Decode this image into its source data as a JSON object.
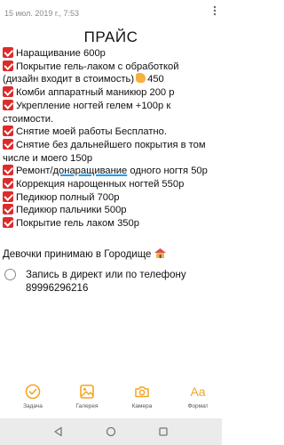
{
  "header": {
    "timestamp": "15 июл. 2019 г., 7:53"
  },
  "note": {
    "title": "ПРАЙС",
    "lines": [
      {
        "segments": [
          "Наращивание 600р"
        ]
      },
      {
        "segments": [
          "Покрытие гель-лаком с обработкой"
        ]
      },
      {
        "segments": [
          "(дизайн входит в стоимость)",
          "450"
        ]
      },
      {
        "segments": [
          "Комби аппаратный маникюр 200 р"
        ]
      },
      {
        "segments": [
          "Укрепление ногтей гелем +100р к"
        ]
      },
      {
        "segments": [
          "стоимости."
        ]
      },
      {
        "segments": [
          "Снятие моей работы Бесплатно."
        ]
      },
      {
        "segments": [
          "Снятие без дальнейшего покрытия в том"
        ]
      },
      {
        "segments": [
          "числе и моего 150р"
        ]
      },
      {
        "segments": [
          "Ремонт/",
          "донаращивание",
          " одного ногтя 50р"
        ]
      },
      {
        "segments": [
          "Коррекция нарощенных ногтей 550р"
        ]
      },
      {
        "segments": [
          "Педикюр полный 700р"
        ]
      },
      {
        "segments": [
          "Педикюр пальчики 500р"
        ]
      },
      {
        "segments": [
          "Покрытие гель лаком 350р"
        ]
      }
    ],
    "greeting": "Девочки принимаю в Городище",
    "checklist": {
      "line1": "Запись в директ или по телефону",
      "line2": "89996296216"
    }
  },
  "toolbar": {
    "items": [
      {
        "label": "Задача",
        "icon": "task-check-icon"
      },
      {
        "label": "Галерея",
        "icon": "gallery-icon"
      },
      {
        "label": "Камера",
        "icon": "camera-icon"
      },
      {
        "label": "Формат",
        "icon": "format-icon",
        "glyph": "Aa"
      }
    ]
  },
  "colors": {
    "accent": "#f4a623",
    "check": "#dd2b2b",
    "underline": "#1aa0ff"
  }
}
